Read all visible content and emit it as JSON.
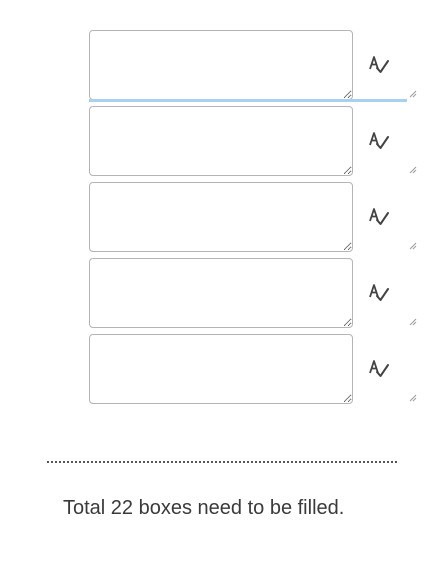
{
  "form": {
    "fields": [
      {
        "value": "",
        "placeholder": "",
        "icon": "spell-check-icon"
      },
      {
        "value": "",
        "placeholder": "",
        "icon": "spell-check-icon"
      },
      {
        "value": "",
        "placeholder": "",
        "icon": "spell-check-icon"
      },
      {
        "value": "",
        "placeholder": "",
        "icon": "spell-check-icon"
      },
      {
        "value": "",
        "placeholder": "",
        "icon": "spell-check-icon"
      }
    ]
  },
  "footer": {
    "summary": "Total 22 boxes need to be filled."
  },
  "colors": {
    "field_border": "#b4b4b4",
    "focus_underline": "#a9d0ef",
    "icon": "#444444",
    "text": "#3a3a3a"
  }
}
